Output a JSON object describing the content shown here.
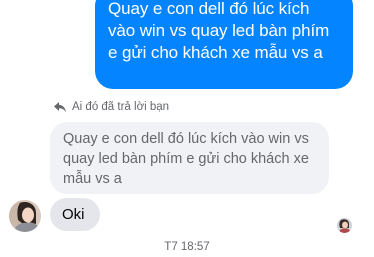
{
  "sent_message": {
    "text": "Quay e con dell đó lúc kích vào win vs quay led bàn phím e gửi cho khách xe mẫu vs a"
  },
  "reply": {
    "note": "Ai đó đã trả lời bạn",
    "icon": "reply-arrow-icon",
    "quoted_text": "Quay e con dell đó lúc kích vào win vs quay led bàn phím e gửi cho khách xe mẫu vs a"
  },
  "received_message": {
    "text": "Oki"
  },
  "timestamp": "T7 18:57",
  "colors": {
    "sent_bubble": "#0584ff",
    "received_bubble": "#e4e6eb",
    "quoted_bubble": "#f0f2f5",
    "muted_text": "#65676b"
  }
}
